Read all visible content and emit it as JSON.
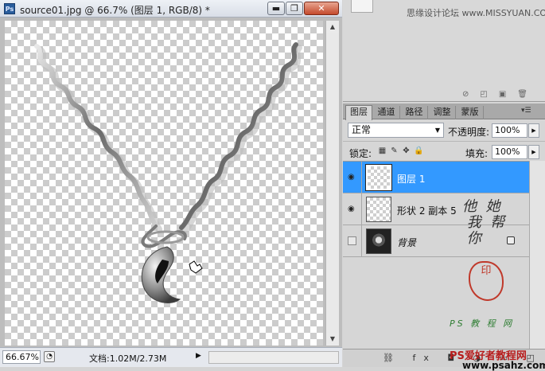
{
  "document": {
    "app_badge": "Ps",
    "title": "source01.jpg @ 66.7% (图层 1, RGB/8) *",
    "window_buttons": {
      "minimize": "▬",
      "maximize": "❐",
      "close": "✕"
    },
    "zoom": "66.67%",
    "doc_info": "文档:1.02M/2.73M"
  },
  "top_panel": {
    "watermark": "思缘设计论坛 www.MISSYUAN.COM"
  },
  "layers_panel": {
    "tabs": [
      {
        "label": "图层",
        "active": true
      },
      {
        "label": "通道",
        "active": false
      },
      {
        "label": "路径",
        "active": false
      },
      {
        "label": "调整",
        "active": false
      },
      {
        "label": "蒙版",
        "active": false
      }
    ],
    "blend_mode": "正常",
    "opacity_label": "不透明度:",
    "opacity_value": "100%",
    "lock_label": "锁定:",
    "fill_label": "填充:",
    "fill_value": "100%",
    "layers": [
      {
        "name": "图层 1",
        "visible": true,
        "selected": true,
        "thumb": "transparent",
        "locked": false
      },
      {
        "name": "形状 2 副本 5",
        "visible": true,
        "selected": false,
        "thumb": "transparent",
        "locked": false
      },
      {
        "name": "背景",
        "visible": false,
        "selected": false,
        "thumb": "photo",
        "locked": true
      }
    ]
  },
  "watermarks": {
    "calligraphy": "他  她\n 我  帮\n 你   ",
    "seal": "印",
    "ps_tag": "PS 教 程 网",
    "site_name": "PS爱好者教程网",
    "site_url": "www.psahz.com"
  },
  "colors": {
    "selection": "#3399ff",
    "close_button": "#c44a2c"
  }
}
